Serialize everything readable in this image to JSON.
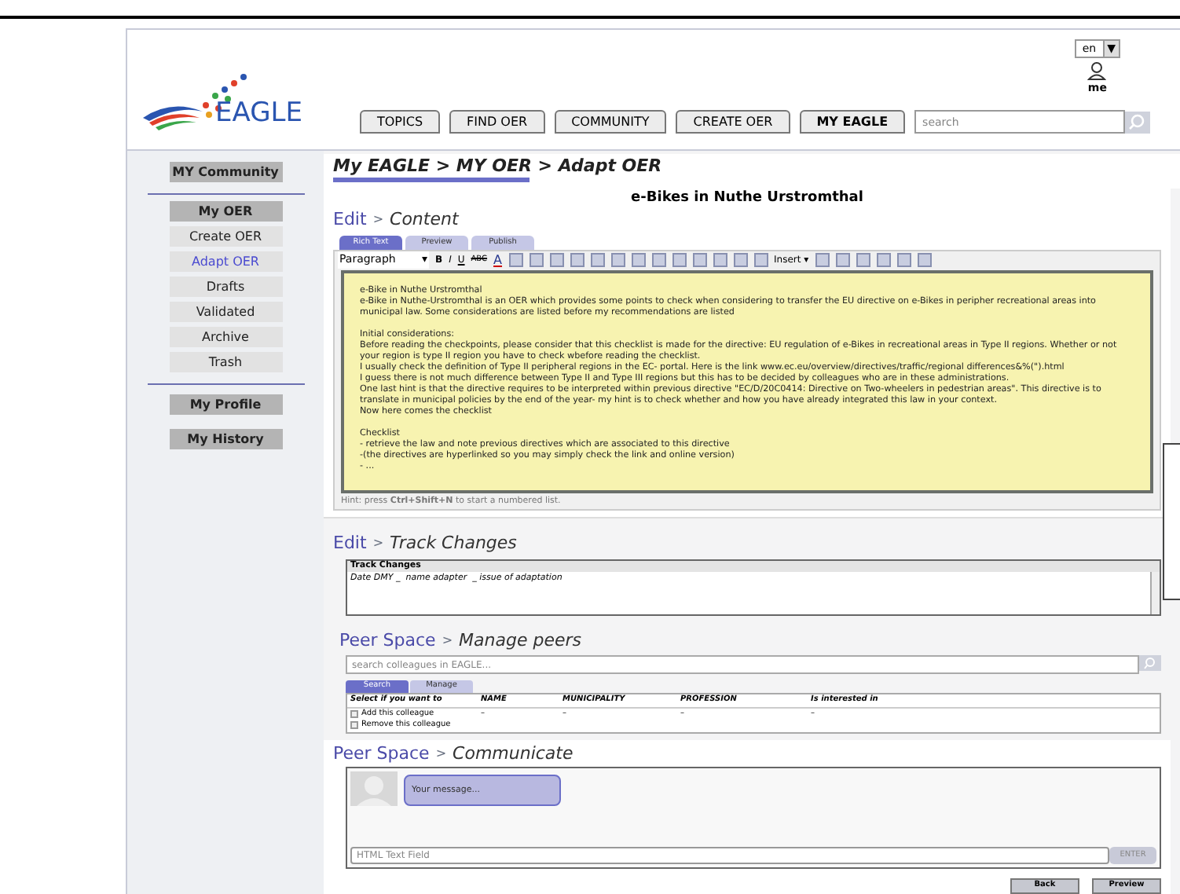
{
  "header": {
    "logo": "EAGLE",
    "language": "en",
    "language_caret": "▼",
    "user_label": "me",
    "search": {
      "placeholder": "search"
    },
    "nav": [
      {
        "label": "TOPICS",
        "selected": false
      },
      {
        "label": "FIND OER",
        "selected": false
      },
      {
        "label": "COMMUNITY",
        "selected": false
      },
      {
        "label": "CREATE OER",
        "selected": false
      },
      {
        "label": "MY EAGLE",
        "selected": true
      }
    ]
  },
  "sidebar": {
    "items": [
      {
        "label": "MY Community",
        "kind": "section",
        "selected": false
      },
      {
        "label": "My OER",
        "kind": "section",
        "selected": false
      },
      {
        "label": "Create OER",
        "kind": "sub",
        "selected": false
      },
      {
        "label": "Adapt OER",
        "kind": "sub",
        "selected": true
      },
      {
        "label": "Drafts",
        "kind": "sub",
        "selected": false
      },
      {
        "label": "Validated",
        "kind": "sub",
        "selected": false
      },
      {
        "label": "Archive",
        "kind": "sub",
        "selected": false
      },
      {
        "label": "Trash",
        "kind": "sub",
        "selected": false
      },
      {
        "label": "My Profile",
        "kind": "section",
        "selected": false
      },
      {
        "label": "My History",
        "kind": "section",
        "selected": false
      }
    ]
  },
  "breadcrumb": "My EAGLE > MY OER > Adapt OER",
  "oer_title": "e-Bikes in Nuthe Urstromthal",
  "content_section": {
    "link": "Edit",
    "separator": ">",
    "title": "Content",
    "tabs": [
      {
        "label": "Rich Text",
        "selected": true
      },
      {
        "label": "Preview",
        "selected": false
      },
      {
        "label": "Publish",
        "selected": false
      }
    ],
    "toolbar": {
      "format": "Paragraph",
      "format_caret": "▾",
      "bold": "B",
      "italic": "I",
      "underline": "U",
      "strike": "ABC",
      "font_color_label": "A",
      "insert": "Insert ▾"
    },
    "paragraphs": [
      [
        "e-Bike in Nuthe Urstromthal",
        "e-Bike in Nuthe-Urstromthal is an OER which provides some points to check when considering to transfer the EU directive on e-Bikes in peripher recreational areas into municipal law. Some considerations are listed before my recommendations are listed"
      ],
      [
        "Initial considerations:",
        "Before reading the checkpoints, please consider that this checklist is made for the directive: EU regulation of e-Bikes in recreational areas in Type II regions. Whether or not your region is type II region you have to check wbefore reading the checklist.",
        "I usually check the definition of Type II peripheral regions in the EC- portal. Here is the link www.ec.eu/overview/directives/traffic/regional differences&%(\").html",
        "I guess there is not much difference between Type II and Type III regions but this has to be decided by colleagues who are in these administrations.",
        "One last hint is that the directive requires to be interpreted within previous directive \"EC/D/20C0414: Directive on Two-wheelers in pedestrian areas\". This directive is to translate in municipal policies by the end of the year- my hint is to check whether and how you have already integrated this law in your context.",
        "Now here comes the checklist"
      ],
      [
        "Checklist",
        "- retrieve the law and note previous directives which are associated to this directive",
        "-(the directives are hyperlinked so you may simply check  the link and online version)",
        "- ..."
      ]
    ],
    "hint": "Hint: press **Ctrl+Shift+N** to start a numbered list."
  },
  "track_section": {
    "link": "Edit",
    "separator": ">",
    "title": "Track Changes",
    "box_title": "Track Changes",
    "entry": "Date DMY _  name adapter  _ issue of adaptation"
  },
  "peers_section": {
    "link": "Peer Space",
    "separator": ">",
    "title": "Manage peers",
    "search": {
      "placeholder": "search colleagues in EAGLE..."
    },
    "tabs": [
      {
        "label": "Search",
        "selected": true
      },
      {
        "label": "Manage",
        "selected": false
      }
    ],
    "columns": [
      "Select if you want to",
      "NAME",
      "MUNICIPALITY",
      "PROFESSION",
      "Is interested in"
    ],
    "rows": [
      {
        "checked": false,
        "cells": [
          "Add this colleague",
          "–",
          "–",
          "–",
          "–"
        ]
      },
      {
        "checked": false,
        "cells": [
          "Remove this colleague"
        ]
      }
    ]
  },
  "communicate_section": {
    "link": "Peer Space",
    "separator": ">",
    "title": "Communicate",
    "message": "Your message...",
    "input": {
      "placeholder": "HTML Text Field"
    },
    "send": "ENTER"
  },
  "buttons": [
    "Back",
    "Preview"
  ]
}
